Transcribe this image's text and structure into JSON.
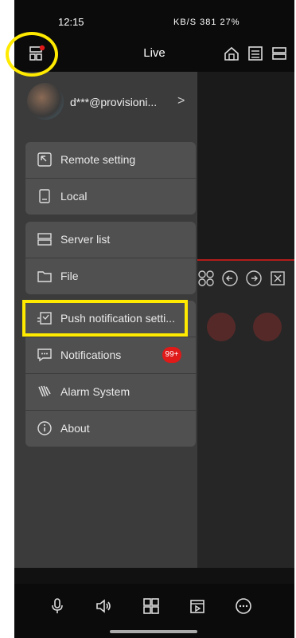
{
  "status": {
    "time": "12:15",
    "right": "KB/S 381  27%"
  },
  "header": {
    "title": "Live"
  },
  "profile": {
    "email": "d***@provisioni...",
    "chevron": ">"
  },
  "drawer": {
    "group1": [
      {
        "label": "Remote setting",
        "icon": "remote-setting-icon"
      },
      {
        "label": "Local",
        "icon": "local-device-icon"
      }
    ],
    "group2": [
      {
        "label": "Server list",
        "icon": "server-list-icon"
      },
      {
        "label": "File",
        "icon": "folder-icon"
      }
    ],
    "group3": [
      {
        "label": "Push notification setti...",
        "icon": "push-notification-icon"
      },
      {
        "label": "Notifications",
        "icon": "notifications-icon",
        "badge": "99+"
      },
      {
        "label": "Alarm System",
        "icon": "alarm-system-icon"
      },
      {
        "label": "About",
        "icon": "about-icon"
      }
    ]
  },
  "colors": {
    "highlight": "#ffea00",
    "badge": "#e01919",
    "drawer": "#3b3b3b"
  }
}
